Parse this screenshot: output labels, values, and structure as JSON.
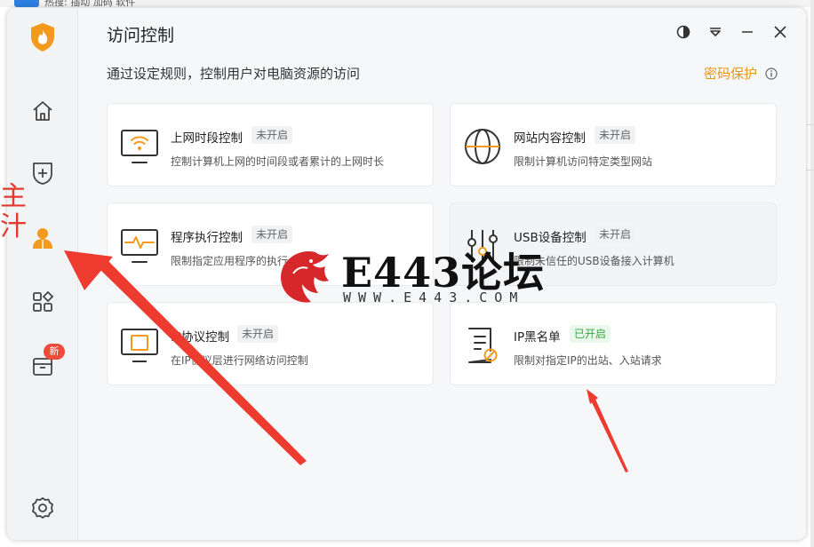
{
  "background": {
    "hot_search_text": "热搜: 插动 加码 软件",
    "left_red_chars": "主\n汁"
  },
  "app": {
    "page_title": "访问控制",
    "subtitle": "通过设定规则，控制用户对电脑资源的访问",
    "password_link": "密码保护",
    "window_controls": [
      "theme-toggle",
      "dropdown",
      "minimize",
      "close"
    ]
  },
  "sidebar": {
    "items": [
      {
        "icon": "logo-shield-flame-icon"
      },
      {
        "icon": "home-icon"
      },
      {
        "icon": "shield-plus-icon"
      },
      {
        "icon": "user-icon",
        "active": true
      },
      {
        "icon": "apps-grid-icon"
      },
      {
        "icon": "toolbox-icon",
        "badge": "新"
      },
      {
        "icon": "settings-gear-icon"
      }
    ]
  },
  "cards": [
    {
      "title": "上网时段控制",
      "status": "未开启",
      "desc": "控制计算机上网的时间段或者累计的上网时长",
      "icon": "monitor-wifi-icon"
    },
    {
      "title": "网站内容控制",
      "status": "未开启",
      "desc": "限制计算机访问特定类型网站",
      "icon": "globe-icon"
    },
    {
      "title": "程序执行控制",
      "status": "未开启",
      "desc": "限制指定应用程序的执行",
      "icon": "monitor-pulse-icon"
    },
    {
      "title": "USB设备控制",
      "status": "未开启",
      "desc": "限制未信任的USB设备接入计算机",
      "icon": "usb-sliders-icon"
    },
    {
      "title": "IP协议控制",
      "status": "未开启",
      "desc": "在IP协议层进行网络访问控制",
      "icon": "monitor-ip-icon"
    },
    {
      "title": "IP黑名单",
      "status": "已开启",
      "desc": "限制对指定IP的出站、入站请求",
      "icon": "blacklist-document-icon"
    }
  ],
  "watermark": {
    "name": "E443论坛",
    "url": "WWW.E443.COM"
  },
  "colors": {
    "accent_orange": "#f39a1e",
    "status_on_green": "#39a846",
    "arrow_red": "#ee3b2f"
  }
}
